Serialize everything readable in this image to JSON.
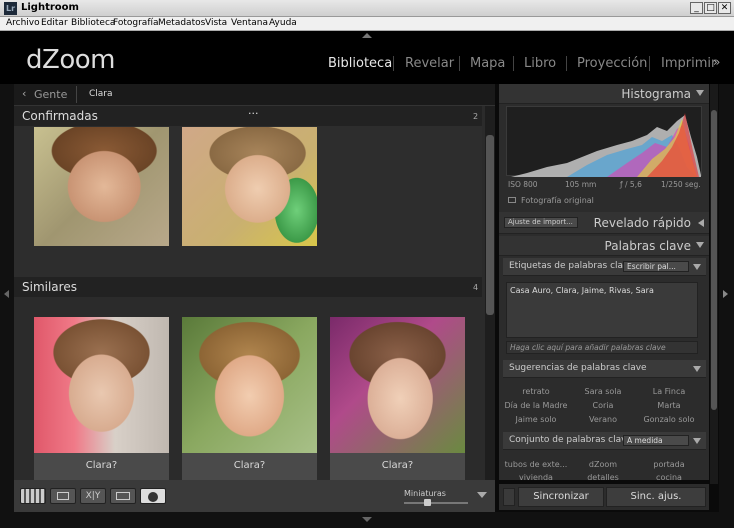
{
  "window": {
    "title": "Lightroom",
    "icon_text": "Lr",
    "controls": [
      "_",
      "□",
      "✕"
    ]
  },
  "menu": [
    "Archivo",
    "Editar",
    "Biblioteca",
    "Fotografía",
    "Metadatos",
    "Vista",
    "Ventana",
    "Ayuda"
  ],
  "identity_plate": "dZoom",
  "modules": [
    "Biblioteca",
    "Revelar",
    "Mapa",
    "Libro",
    "Proyección",
    "Imprimir"
  ],
  "breadcrumb": {
    "back": "Gente",
    "current": "Clara"
  },
  "sections": {
    "confirmed": {
      "title": "Confirmadas",
      "count": "2",
      "menu": "···"
    },
    "similar": {
      "title": "Similares",
      "count": "4"
    }
  },
  "similar_labels": [
    "Clara?",
    "Clara?",
    "Clara?"
  ],
  "toolbar": {
    "thumbnails_label": "Miniaturas"
  },
  "histogram": {
    "title": "Histograma",
    "iso": "ISO 800",
    "focal": "105 mm",
    "aperture": "ƒ / 5,6",
    "shutter": "1/250 seg.",
    "original_label": "Fotografía original"
  },
  "quick_develop": {
    "title": "Revelado rápido",
    "preset": "Ajuste de import..."
  },
  "keywords": {
    "title": "Palabras clave",
    "tags_label": "Etiquetas de palabras clave",
    "tags_mode": "Escribir pal...",
    "tags_value": "Casa Auro, Clara, Jaime, Rivas, Sara",
    "add_hint": "Haga clic aquí para añadir palabras clave",
    "suggestions_label": "Sugerencias de palabras clave",
    "suggestions": [
      "retrato",
      "Sara sola",
      "La Finca",
      "Día de la Madre",
      "Coria",
      "Marta",
      "Jaime solo",
      "Verano",
      "Gonzalo solo"
    ],
    "set_label": "Conjunto de palabras clave",
    "set_mode": "A medida",
    "set_items": [
      "tubos de exte...",
      "dZoom",
      "portada",
      "vivienda",
      "detalles",
      "cocina"
    ]
  },
  "buttons": {
    "sync": "Sincronizar",
    "sync_settings": "Sinc. ajus."
  }
}
